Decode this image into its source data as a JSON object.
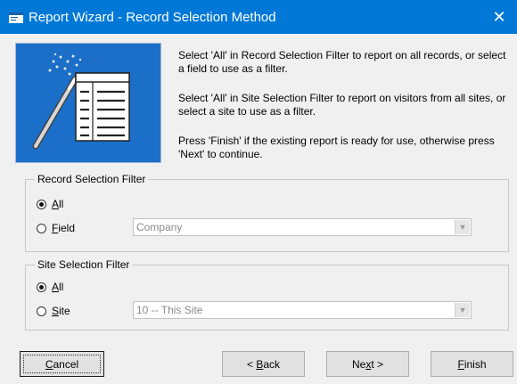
{
  "window": {
    "title": "Report Wizard - Record Selection Method",
    "close_glyph": "✕"
  },
  "instructions": [
    "Select 'All' in Record Selection Filter to report on all records, or select a field to use as a filter.",
    "Select 'All' in Site Selection Filter to report on visitors from all sites, or select a site to use as a filter.",
    "Press 'Finish' if the existing report is ready for use, otherwise press 'Next' to continue."
  ],
  "record_filter": {
    "legend": "Record Selection Filter",
    "all_radio": {
      "mnemonic": "A",
      "rest": "ll",
      "checked": true
    },
    "field_radio": {
      "mnemonic": "F",
      "rest": "ield",
      "checked": false
    },
    "field_select": {
      "value": "Company"
    }
  },
  "site_filter": {
    "legend": "Site Selection Filter",
    "all_radio": {
      "mnemonic": "A",
      "rest": "ll",
      "checked": true
    },
    "site_radio": {
      "mnemonic": "S",
      "rest": "ite",
      "checked": false
    },
    "site_select": {
      "value": "10 -- This Site"
    }
  },
  "buttons": {
    "cancel": {
      "mnemonic": "C",
      "rest": "ancel"
    },
    "back": {
      "prefix": "< ",
      "mnemonic": "B",
      "rest": "ack"
    },
    "next": {
      "prefix": "Ne",
      "mnemonic": "x",
      "rest": "t >"
    },
    "finish": {
      "mnemonic": "F",
      "rest": "inish"
    }
  },
  "icons": [
    "app-icon",
    "close-icon",
    "magic-wand-icon",
    "report-table-icon",
    "dropdown-arrow-icon"
  ],
  "colors": {
    "titlebar": "#0078d7",
    "image_bg": "#1b6fc9"
  }
}
